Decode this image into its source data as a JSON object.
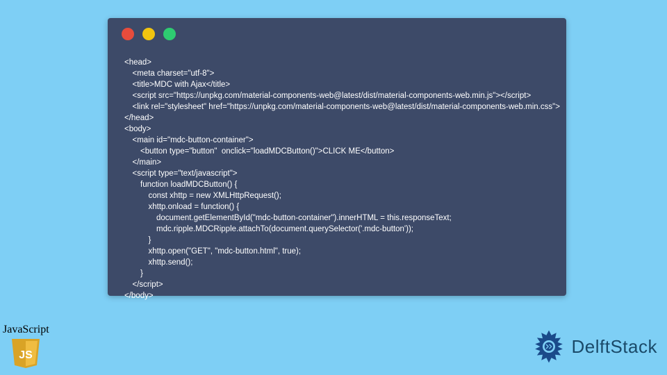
{
  "code_window": {
    "lines": [
      "<head>",
      " <meta charset=\"utf-8\">",
      " <title>MDC with Ajax</title>",
      " <script src=\"https://unpkg.com/material-components-web@latest/dist/material-components-web.min.js\"></script>",
      " <link rel=\"stylesheet\" href=\"https://unpkg.com/material-components-web@latest/dist/material-components-web.min.css\">",
      "</head>",
      "<body>",
      " <main id=\"mdc-button-container\">",
      "  <button type=\"button\"  onclick=\"loadMDCButton()\">CLICK ME</button>",
      " </main>",
      " <script type=\"text/javascript\">",
      "  function loadMDCButton() {",
      "   const xhttp = new XMLHttpRequest();",
      "   xhttp.onload = function() {",
      "    document.getElementById(\"mdc-button-container\").innerHTML = this.responseText;",
      "    mdc.ripple.MDCRipple.attachTo(document.querySelector('.mdc-button'));",
      "   }",
      "   xhttp.open(\"GET\", \"mdc-button.html\", true);",
      "   xhttp.send();",
      "  }",
      " </script>",
      "</body>"
    ]
  },
  "js_badge": {
    "label": "JavaScript",
    "logo_text": "JS"
  },
  "brand": {
    "text": "DelftStack"
  }
}
